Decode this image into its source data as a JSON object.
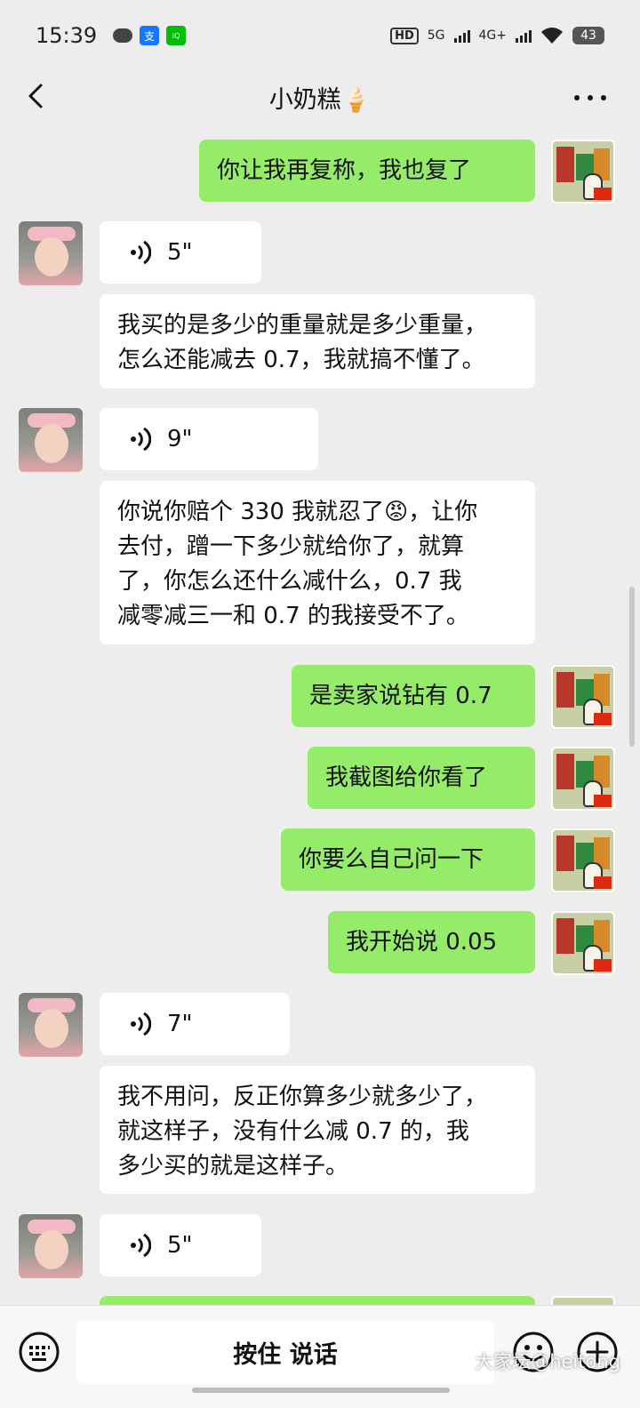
{
  "status_bar": {
    "time": "15:39",
    "icons": [
      "wechat-icon",
      "alipay-icon",
      "iqiyi-icon"
    ],
    "hd": "HD",
    "net1": "5G",
    "net2": "4G+",
    "battery": "43"
  },
  "header": {
    "title": "小奶糕🍦"
  },
  "messages": [
    {
      "from": "me",
      "type": "text",
      "text": "你让我再复称，我也复了"
    },
    {
      "from": "other",
      "type": "voice",
      "duration": "5\""
    },
    {
      "from": "other",
      "type": "text",
      "text": "我买的是多少的重量就是多少重量，\n怎么还能减去 0.7，我就搞不懂了。"
    },
    {
      "from": "other",
      "type": "voice",
      "duration": "9\""
    },
    {
      "from": "other",
      "type": "text",
      "text": "你说你赔个 330 我就忍了😡，让你\n去付，蹭一下多少就给你了，就算\n了，你怎么还什么减什么，0.7 我\n减零减三一和 0.7 的我接受不了。"
    },
    {
      "from": "me",
      "type": "text",
      "text": "是卖家说钻有 0.7"
    },
    {
      "from": "me",
      "type": "text",
      "text": "我截图给你看了"
    },
    {
      "from": "me",
      "type": "text",
      "text": "你要么自己问一下"
    },
    {
      "from": "me",
      "type": "text",
      "text": "我开始说 0.05"
    },
    {
      "from": "other",
      "type": "voice",
      "duration": "7\""
    },
    {
      "from": "other",
      "type": "text",
      "text": "我不用问，反正你算多少就多少了，\n就这样子，没有什么减 0.7 的，我\n多少买的就是这样子。"
    },
    {
      "from": "other",
      "type": "voice",
      "duration": "5\""
    }
  ],
  "input_bar": {
    "hold_to_talk": "按住 说话"
  },
  "watermark": "大家坛@heitong",
  "colors": {
    "background": "#ededed",
    "my_bubble": "#95ec69",
    "their_bubble": "#ffffff"
  }
}
